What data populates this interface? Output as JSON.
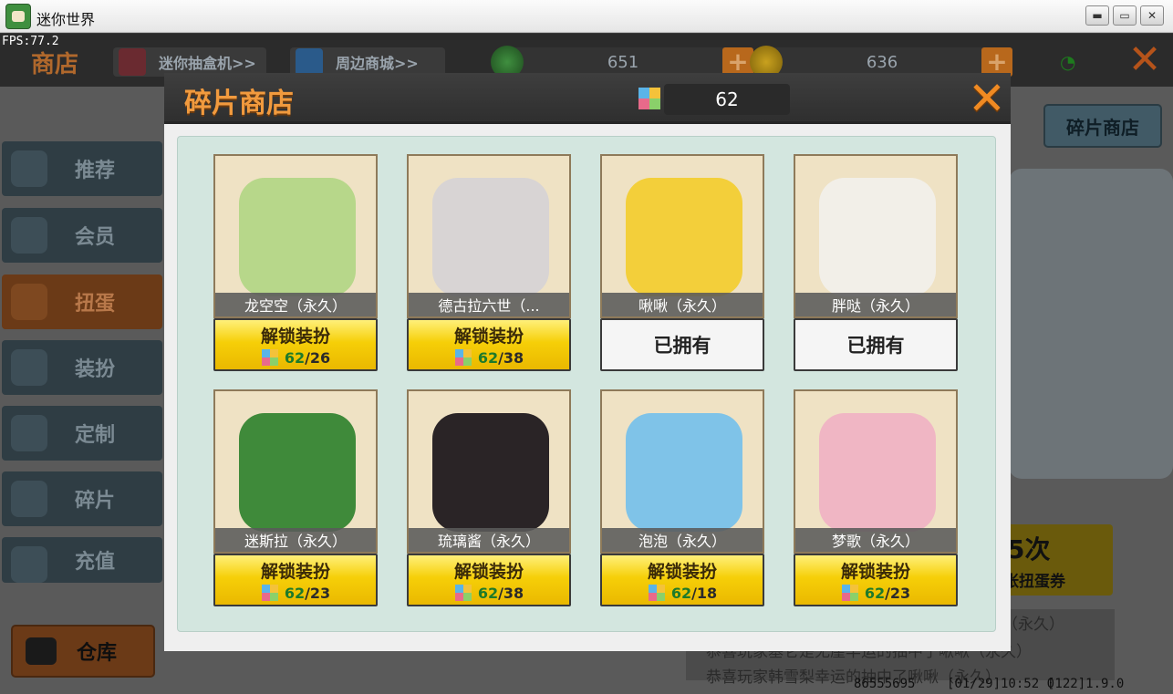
{
  "window": {
    "title": "迷你世界",
    "minimize_icon": "minimize-icon",
    "maximize_icon": "maximize-icon",
    "close_icon": "close-icon"
  },
  "fps": "FPS:77.2",
  "topbar": {
    "title": "商店",
    "links": [
      {
        "label": "迷你抽盒机>>",
        "icon": "gashapon-icon"
      },
      {
        "label": "周边商城>>",
        "icon": "shopping-bag-icon"
      }
    ],
    "currencies": [
      {
        "value": "651",
        "icon": "green-coin-icon"
      },
      {
        "value": "636",
        "icon": "gold-coin-icon"
      }
    ]
  },
  "sidebar": {
    "items": [
      {
        "label": "推荐",
        "icon": "thumbs-up-icon"
      },
      {
        "label": "会员",
        "icon": "vip-icon"
      },
      {
        "label": "扭蛋",
        "icon": "capsule-icon",
        "active": true
      },
      {
        "label": "装扮",
        "icon": "shirt-icon"
      },
      {
        "label": "定制",
        "icon": "pencil-icon"
      },
      {
        "label": "碎片",
        "icon": "puzzle-icon"
      },
      {
        "label": "充值",
        "icon": "coins-icon"
      }
    ],
    "warehouse_label": "仓库"
  },
  "background": {
    "shop_button": "碎片商店",
    "ticket_big": "5次",
    "ticket_small": "张扭蛋券",
    "log": [
      "啾（永久）",
      "恭喜玩家基仑是无崖丰运的抽中了啾啾（永久）",
      "恭喜玩家韩雪梨幸运的抽中了啾啾（永久）"
    ],
    "status": [
      "86555695",
      "[01/29]10:52 0",
      "[122]1.9.0"
    ]
  },
  "modal": {
    "title": "碎片商店",
    "fragment_count": "62",
    "unlock_label": "解锁装扮",
    "owned_label": "已拥有",
    "cards": [
      {
        "name": "龙空空（永久）",
        "state": "unlock",
        "have": "62",
        "need": "/26",
        "color": "#b7d78a"
      },
      {
        "name": "德古拉六世（...",
        "state": "unlock",
        "have": "62",
        "need": "/38",
        "color": "#d8d4d4"
      },
      {
        "name": "啾啾（永久）",
        "state": "owned",
        "color": "#f3cf3a"
      },
      {
        "name": "胖哒（永久）",
        "state": "owned",
        "color": "#f2efe8"
      },
      {
        "name": "迷斯拉（永久）",
        "state": "unlock",
        "have": "62",
        "need": "/23",
        "color": "#3f8a3a"
      },
      {
        "name": "琉璃酱（永久）",
        "state": "unlock",
        "have": "62",
        "need": "/38",
        "color": "#2a2426"
      },
      {
        "name": "泡泡（永久）",
        "state": "unlock",
        "have": "62",
        "need": "/18",
        "color": "#7fc3e8"
      },
      {
        "name": "梦歌（永久）",
        "state": "unlock",
        "have": "62",
        "need": "/23",
        "color": "#f0b6c4"
      }
    ]
  }
}
